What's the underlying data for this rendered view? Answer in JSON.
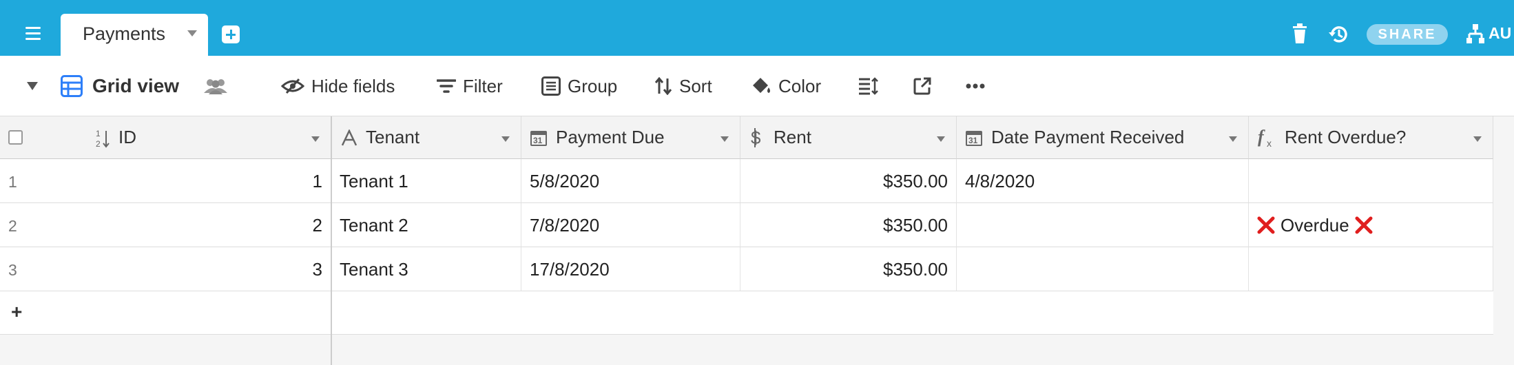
{
  "tabs": [
    {
      "label": "Payments"
    }
  ],
  "topbar": {
    "share_label": "SHARE",
    "automations_label": "AU"
  },
  "toolbar": {
    "view_name": "Grid view",
    "hide_fields": "Hide fields",
    "filter": "Filter",
    "group": "Group",
    "sort": "Sort",
    "color": "Color"
  },
  "columns": [
    {
      "name": "ID",
      "icon": "number-sort-icon"
    },
    {
      "name": "Tenant",
      "icon": "text-field-icon"
    },
    {
      "name": "Payment Due",
      "icon": "calendar-icon"
    },
    {
      "name": "Rent",
      "icon": "currency-icon"
    },
    {
      "name": "Date Payment Received",
      "icon": "calendar-icon"
    },
    {
      "name": "Rent Overdue?",
      "icon": "formula-icon"
    }
  ],
  "rows": [
    {
      "num": "1",
      "id": "1",
      "tenant": "Tenant 1",
      "due": "5/8/2020",
      "rent": "$350.00",
      "received": "4/8/2020",
      "overdue": ""
    },
    {
      "num": "2",
      "id": "2",
      "tenant": "Tenant 2",
      "due": "7/8/2020",
      "rent": "$350.00",
      "received": "",
      "overdue": "Overdue"
    },
    {
      "num": "3",
      "id": "3",
      "tenant": "Tenant 3",
      "due": "17/8/2020",
      "rent": "$350.00",
      "received": "",
      "overdue": ""
    }
  ],
  "overdue_mark": "❌",
  "add_row_label": "+",
  "colors": {
    "topbar": "#1fa9dc",
    "accent": "#2d7ff9",
    "overdue_x": "#e01e1e"
  }
}
